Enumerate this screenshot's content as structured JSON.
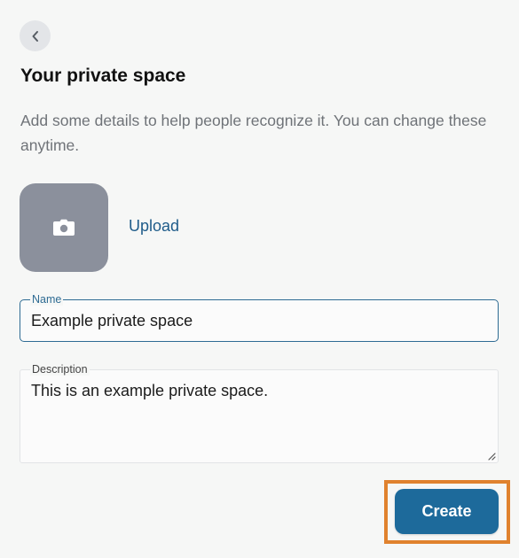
{
  "header": {
    "back_icon": "chevron-left-icon",
    "title": "Your private space",
    "subtitle": "Add some details to help people recognize it. You can change these anytime."
  },
  "avatar": {
    "icon": "camera-icon",
    "upload_label": "Upload"
  },
  "form": {
    "name": {
      "label": "Name",
      "value": "Example private space"
    },
    "description": {
      "label": "Description",
      "value": "This is an example private space."
    }
  },
  "actions": {
    "create_label": "Create"
  },
  "colors": {
    "accent": "#1d6a9b",
    "highlight": "#e0822e",
    "avatar_bg": "#8b909c",
    "link": "#1f5c8a"
  }
}
